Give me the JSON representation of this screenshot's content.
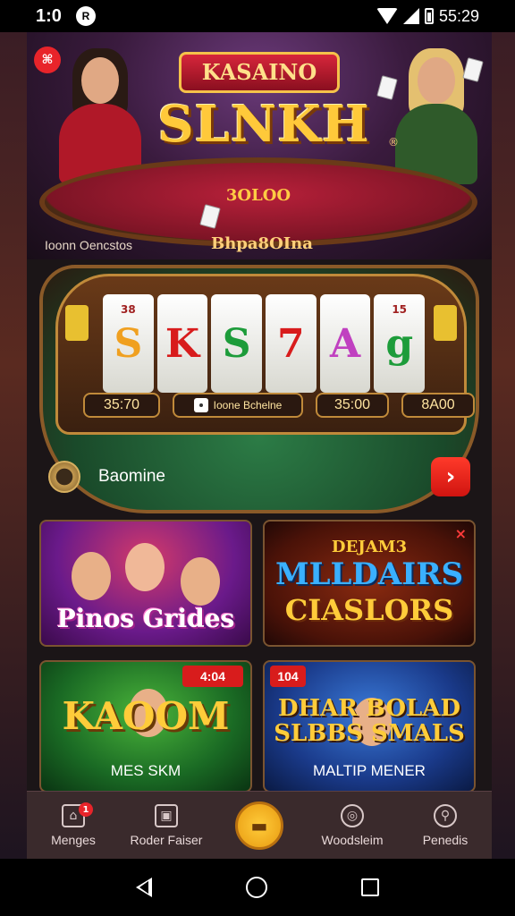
{
  "status_bar": {
    "time": "1:0",
    "icon_letter": "R",
    "clock": "55:29"
  },
  "hero": {
    "badge_symbol": "⌘",
    "subtitle": "KASAINO",
    "title": "SLNKH",
    "trademark": "®",
    "table_label": "3OLOO",
    "caption_left": "Ioonn Oencstos",
    "caption_right": "Bhpa8OIna"
  },
  "slot": {
    "reels": [
      "S",
      "K",
      "S",
      "7",
      "A",
      "g"
    ],
    "reel_top_symbols": [
      "38",
      "",
      "",
      "",
      "",
      "15"
    ],
    "stats": {
      "left": "35:70",
      "middle": "Ioone Bchelne",
      "right_value": "35:00",
      "far_right": "8A00"
    }
  },
  "promo": {
    "label": "Baomine",
    "arrow": "›"
  },
  "games": [
    {
      "title": "Pinos Grides",
      "badge": ""
    },
    {
      "tag": "DEJAM3",
      "title": "MLLDAIRS",
      "title2": "CIASLORS",
      "close": "×"
    },
    {
      "title": "KAOOM",
      "caption": "MES SKM",
      "badge": "4:04"
    },
    {
      "title": "DHAR BOLAD SLBBS SMALS",
      "caption": "MALTIP MENER",
      "badge": "104"
    }
  ],
  "bottom_nav": {
    "items": [
      {
        "label": "Menges",
        "icon": "home-icon",
        "badge": "1"
      },
      {
        "label": "Roder Faiser",
        "icon": "briefcase-icon"
      },
      {
        "label": "",
        "icon": "slot-machine-icon"
      },
      {
        "label": "Woodsleim",
        "icon": "target-icon"
      },
      {
        "label": "Penedis",
        "icon": "search-icon"
      }
    ]
  },
  "colors": {
    "accent_red": "#d81c1c",
    "gold": "#ffcc3a",
    "nav_bg": "#3a2a2c"
  }
}
